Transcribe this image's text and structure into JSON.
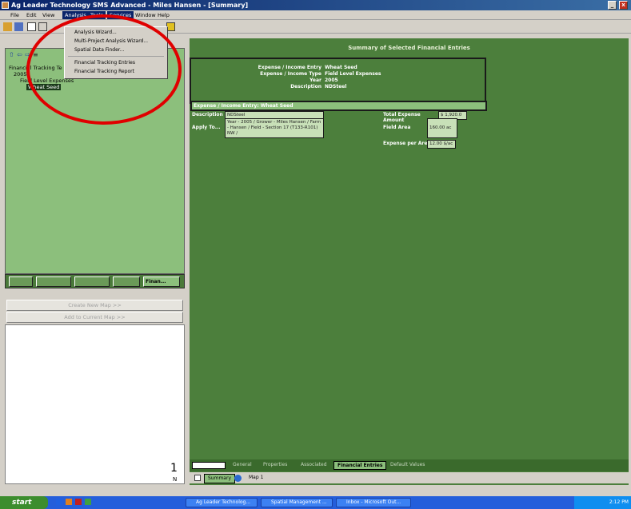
{
  "window": {
    "title": "Ag Leader Technology SMS Advanced - Miles Hansen - [Summary]",
    "min_label": "_",
    "max_label": "▫",
    "close_label": "x"
  },
  "menubar": {
    "items": [
      "File",
      "Edit",
      "View",
      "Analysis",
      "Tools",
      "Services",
      "Window",
      "Help"
    ],
    "active": "Analysis"
  },
  "analysis_menu": {
    "items": [
      "Analysis Wizard...",
      "Multi-Project Analysis Wizard...",
      "Spatial Data Finder...",
      "Financial Tracking Entries",
      "Financial Tracking Report"
    ]
  },
  "tree": {
    "root": "Financial Tracking Te",
    "year": "2005",
    "group": "Field Level Expenses",
    "selected": "Wheat Seed"
  },
  "left_tabs": [
    "",
    "",
    "",
    "",
    "Finan..."
  ],
  "map_buttons": {
    "create": "Create New Map >>",
    "add": "Add to Current Map >>"
  },
  "summary": {
    "title": "Summary of Selected Financial Entries",
    "labels": [
      "Expense / Income Entry",
      "Expense / Income Type",
      "Year",
      "Description"
    ],
    "values": [
      "Wheat Seed",
      "Field Level Expenses",
      "2005",
      "NDSteel"
    ],
    "section_header": "Expense / Income Entry: Wheat Seed",
    "description_label": "Description",
    "description_value": "NDSteel",
    "apply_label": "Apply To...",
    "apply_value": "Year - 2005 / Grower - Miles Hansen / Farm - Hansen / Field - Section 17 (T133-R101) NW /",
    "total_label": "Total Expense Amount",
    "total_value": "$ 1,920.0",
    "area_label": "Field Area",
    "area_value": "160.00 ac",
    "per_area_label": "Expense per Area",
    "per_area_value": "12.00 $/ac"
  },
  "bottom_tabs": [
    "General",
    "Properties",
    "Associated",
    "Financial Entries",
    "Default Values"
  ],
  "bottom_tabs_active": "Financial Entries",
  "view_tabs": [
    "Summary",
    "Map 1"
  ],
  "page_indicator": "1",
  "page_letter": "N",
  "taskbar": {
    "start": "start",
    "tasks": [
      "Ag Leader Technolog...",
      "Spatial Management ...",
      "Inbox - Microsoft Out..."
    ],
    "clock": "2:12 PM"
  }
}
